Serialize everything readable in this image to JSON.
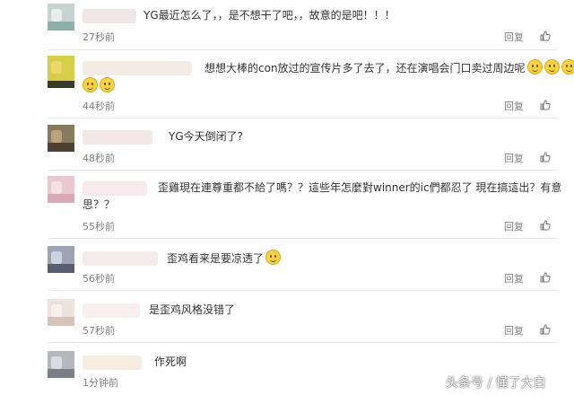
{
  "comments": [
    {
      "text": "YG最近怎么了，，是不想干了吧，，故意的是吧！！！",
      "time": "27秒前",
      "reply": "回复"
    },
    {
      "text": "想想大棒的con放过的宣传片多了去了，还在演唱会门口卖过周边呢",
      "time": "44秒前",
      "reply": "回复"
    },
    {
      "text": "YG今天倒闭了?",
      "time": "48秒前",
      "reply": "回复"
    },
    {
      "text_line1": "歪雞現在連尊重都不給了嗎？？這些年怎麼對winner的ic們都忍了 現在搞這出？有意",
      "text_line2": "思？？",
      "time": "55秒前",
      "reply": "回复"
    },
    {
      "text": "歪鸡看来是要凉透了",
      "time": "56秒前",
      "reply": "回复"
    },
    {
      "text": "是歪鸡风格没错了",
      "time": "57秒前",
      "reply": "回复"
    },
    {
      "text": "作死啊",
      "time": "1分钟前"
    }
  ],
  "watermark": "头条号 / 懂了大白",
  "icons": {
    "like": "thumbs-up-icon",
    "emoji": "smiley-emoji-icon"
  },
  "colors": {
    "text": "#333333",
    "meta": "#808080",
    "divider": "#eaeaea"
  }
}
